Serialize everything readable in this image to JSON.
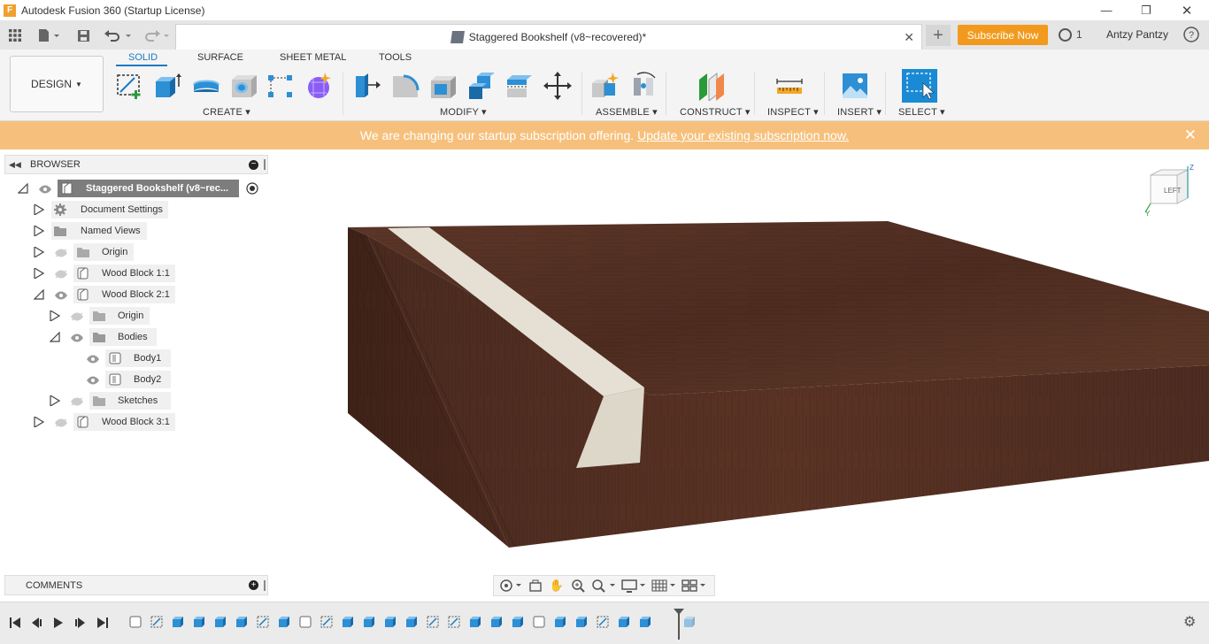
{
  "window": {
    "title": "Autodesk Fusion 360 (Startup License)",
    "app_icon": "F"
  },
  "tabbar": {
    "doc_title": "Staggered Bookshelf (v8~recovered)*",
    "subscribe_label": "Subscribe Now",
    "job_count": "1",
    "user": "Antzy Pantzy",
    "help": "?"
  },
  "ribbon": {
    "workspace": "DESIGN",
    "tabs": [
      "SOLID",
      "SURFACE",
      "SHEET METAL",
      "TOOLS"
    ],
    "groups": [
      "CREATE",
      "MODIFY",
      "ASSEMBLE",
      "CONSTRUCT",
      "INSPECT",
      "INSERT",
      "SELECT"
    ]
  },
  "banner": {
    "text": "We are changing our startup subscription offering.",
    "link": "Update your existing subscription now."
  },
  "browser": {
    "title": "BROWSER",
    "root": "Staggered Bookshelf (v8~rec...",
    "nodes": [
      "Document Settings",
      "Named Views",
      "Origin",
      "Wood Block 1:1",
      "Wood Block 2:1",
      "Origin",
      "Bodies",
      "Body1",
      "Body2",
      "Sketches",
      "Wood Block 3:1"
    ]
  },
  "comments": {
    "title": "COMMENTS"
  },
  "viewcube": {
    "face": "LEFT",
    "axis_z": "Z",
    "axis_y": "Y"
  },
  "colors": {
    "accent": "#1a7bc4",
    "banner": "#f6c07c",
    "subscribe": "#f29a1d",
    "wood": "#5a3324"
  }
}
